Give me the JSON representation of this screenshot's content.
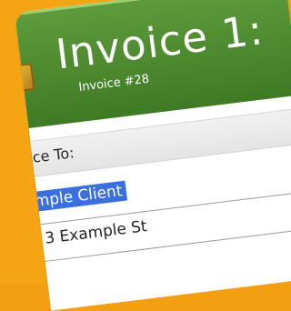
{
  "header": {
    "title": "Invoice 1:",
    "subtitle": "Invoice #28"
  },
  "billing": {
    "invoice_to_label": "oice To:",
    "client_name": "ample Client",
    "address_line": "3 Example St"
  },
  "colors": {
    "frame": "#f5a413",
    "header_green": "#4b8a2f",
    "selection": "#3a6fdc"
  }
}
